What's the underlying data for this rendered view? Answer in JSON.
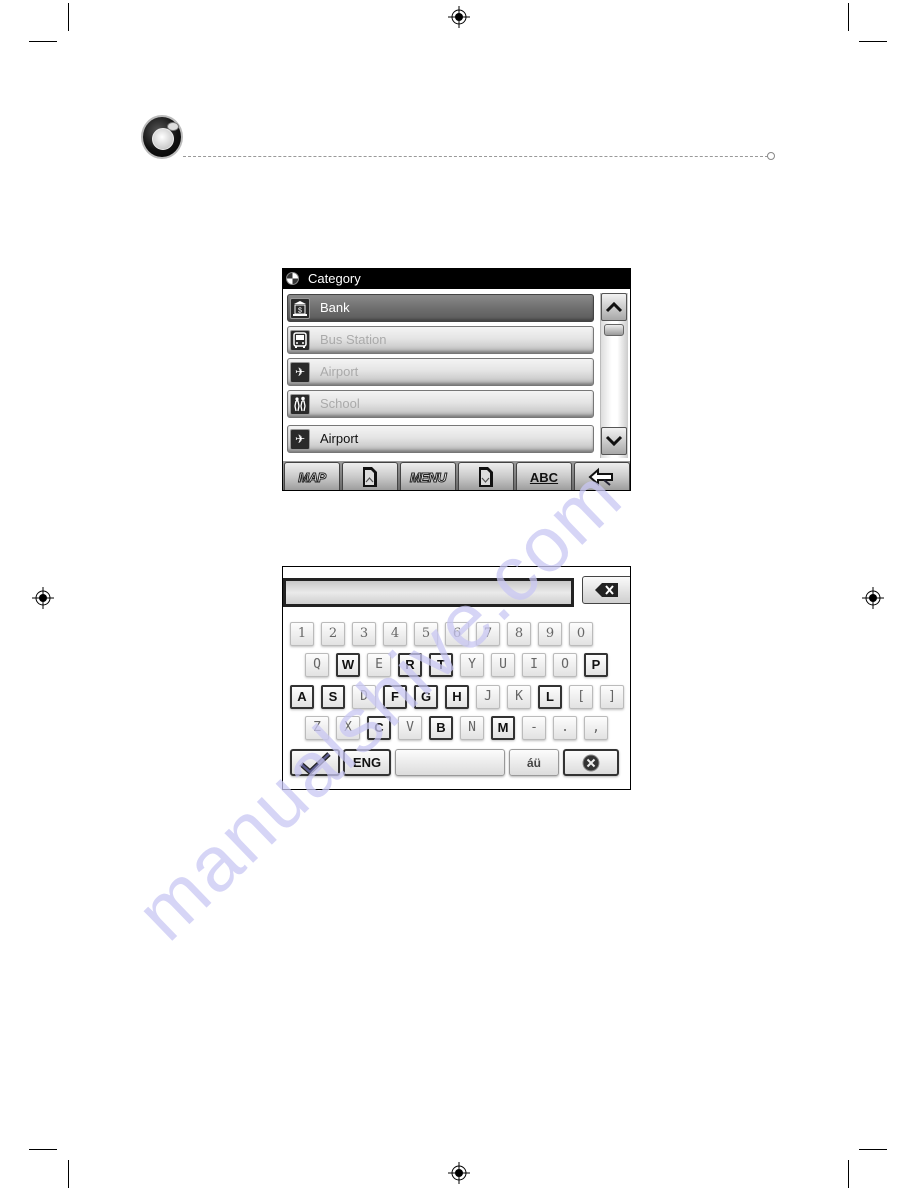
{
  "header": {
    "icon": "compass-icon"
  },
  "category_screen": {
    "title": "Category",
    "title_icon": "poi-globe-icon",
    "items": [
      {
        "label": "Bank",
        "icon": "bank-icon",
        "state": "selected"
      },
      {
        "label": "Bus Station",
        "icon": "bus-icon",
        "state": "dimmed"
      },
      {
        "label": "Airport",
        "icon": "airplane-icon",
        "state": "dimmed"
      },
      {
        "label": "School",
        "icon": "school-children-icon",
        "state": "dimmed"
      },
      {
        "label": "Airport",
        "icon": "airplane-icon",
        "state": "normal"
      }
    ],
    "scrollbar": {
      "up_icon": "chevron-up-icon",
      "down_icon": "chevron-down-icon"
    },
    "toolbar": {
      "map_label": "MAP",
      "page_up_icon": "page-up-icon",
      "menu_label": "MENU",
      "page_down_icon": "page-down-icon",
      "abc_label": "ABC",
      "back_icon": "back-arrow-icon"
    }
  },
  "keyboard_screen": {
    "input_value": "",
    "backspace_icon": "backspace-icon",
    "rows": [
      [
        "1",
        "2",
        "3",
        "4",
        "5",
        "6",
        "7",
        "8",
        "9",
        "0"
      ],
      [
        "Q",
        "W",
        "E",
        "R",
        "T",
        "Y",
        "U",
        "I",
        "O",
        "P"
      ],
      [
        "A",
        "S",
        "D",
        "F",
        "G",
        "H",
        "J",
        "K",
        "L",
        "[",
        "]"
      ],
      [
        "Z",
        "X",
        "C",
        "V",
        "B",
        "N",
        "M",
        "-",
        ".",
        ","
      ]
    ],
    "active_keys": [
      "W",
      "R",
      "T",
      "P",
      "A",
      "S",
      "F",
      "G",
      "H",
      "L",
      "C",
      "B",
      "M"
    ],
    "ok_icon": "checkmark-icon",
    "language_label": "ENG",
    "space_label": "",
    "accent_label": "áü",
    "cancel_icon": "cancel-x-icon"
  },
  "watermark": "manualshive.com",
  "colors": {
    "selected_item": "#6f6f6f",
    "dimmed_text": "#aaaaaa",
    "title_bar": "#000000",
    "watermark": "#c9c7f3"
  }
}
